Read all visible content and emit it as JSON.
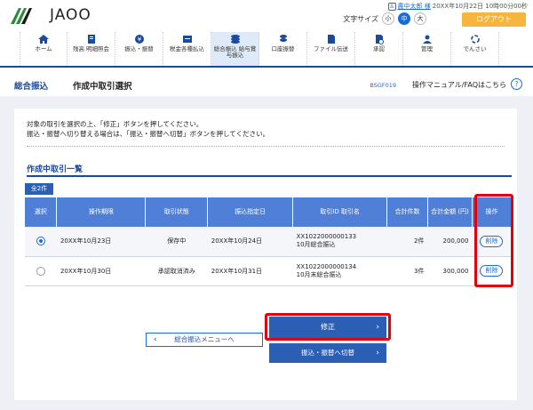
{
  "header": {
    "logo_text": "JAOO",
    "user_icon": "user-icon",
    "user_name": "農中太郎 様",
    "datetime": "20XX年10月22日 10時00分00秒",
    "font_size_label": "文字サイズ",
    "font_sizes": [
      "小",
      "中",
      "大"
    ],
    "logout_label": "ログアウト"
  },
  "nav": [
    {
      "label": "ホーム",
      "icon": "home-icon"
    },
    {
      "label": "残高 明細照会",
      "icon": "passbook-icon"
    },
    {
      "label": "振込・振替",
      "icon": "yen-icon"
    },
    {
      "label": "税金各種払込",
      "icon": "tax-icon"
    },
    {
      "label": "総合振込 給与賞与振込",
      "icon": "coins-icon"
    },
    {
      "label": "口座振替",
      "icon": "transfer-icon"
    },
    {
      "label": "ファイル伝送",
      "icon": "file-icon"
    },
    {
      "label": "承認",
      "icon": "approve-icon"
    },
    {
      "label": "管理",
      "icon": "admin-icon"
    },
    {
      "label": "でんさい",
      "icon": "densai-icon"
    }
  ],
  "titlebar": {
    "category": "総合振込",
    "title": "作成中取引選択",
    "screen_code": "BSGF019",
    "help_text": "操作マニュアル/FAQはこちら",
    "help_icon": "?"
  },
  "instructions": [
    "対象の取引を選択の上、「修正」ボタンを押してください。",
    "振込・振替へ切り替える場合は、「振込・振替へ切替」ボタンを押してください。"
  ],
  "section_title": "作成中取引一覧",
  "count_badge": "全2件",
  "table": {
    "headers": [
      "選択",
      "操作期限",
      "取引状態",
      "振込指定日",
      "取引ID 取引名",
      "合計件数",
      "合計金額 (円)",
      "操作"
    ],
    "rows": [
      {
        "selected": true,
        "deadline": "20XX年10月23日",
        "status": "保存中",
        "date": "20XX年10月24日",
        "id": "XX1022000000133",
        "name": "10月総合振込",
        "count": "2件",
        "amount": "200,000",
        "action": "削除"
      },
      {
        "selected": false,
        "deadline": "20XX年10月30日",
        "status": "承認取消済み",
        "date": "20XX年10月31日",
        "id": "XX1022000000134",
        "name": "10月末総合振込",
        "count": "3件",
        "amount": "300,000",
        "action": "削除"
      }
    ]
  },
  "buttons": {
    "fix": "修正",
    "switch": "振込・振替へ切替",
    "back": "総合振込メニューへ"
  },
  "colors": {
    "primary": "#2a5fb4",
    "header_blue": "#4f7fd6",
    "highlight_red": "#e0000e",
    "logout_orange": "#f6b63d"
  }
}
